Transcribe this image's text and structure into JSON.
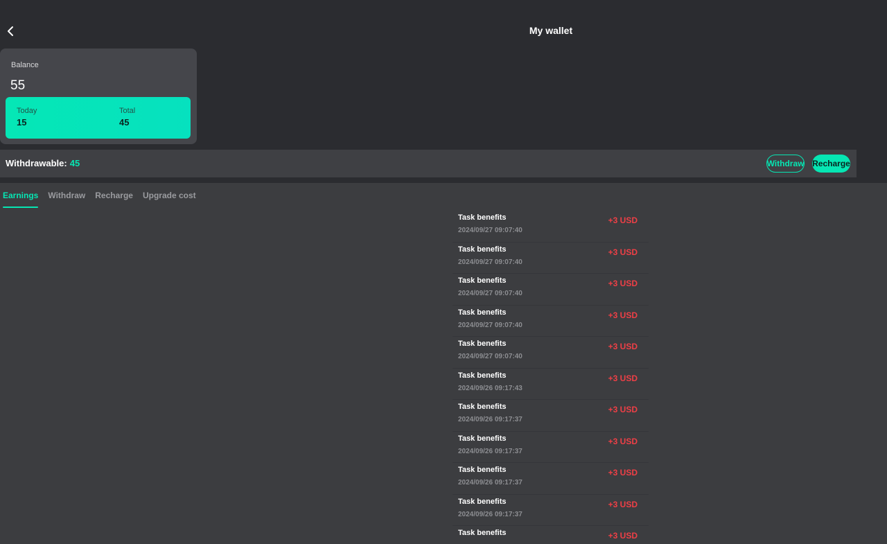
{
  "header": {
    "title": "My wallet",
    "back_icon": "chevron-left-icon"
  },
  "balance": {
    "label": "Balance",
    "value": "55",
    "today_label": "Today",
    "today_value": "15",
    "total_label": "Total",
    "total_value": "45"
  },
  "withdrawable": {
    "label": "Withdrawable:",
    "value": "45",
    "withdraw_button": "Withdraw",
    "recharge_button": "Recharge"
  },
  "tabs": [
    {
      "label": "Earnings",
      "active": true
    },
    {
      "label": "Withdraw",
      "active": false
    },
    {
      "label": "Recharge",
      "active": false
    },
    {
      "label": "Upgrade cost",
      "active": false
    }
  ],
  "records": [
    {
      "title": "Task benefits",
      "time": "2024/09/27 09:07:40",
      "amount": "+3 USD"
    },
    {
      "title": "Task benefits",
      "time": "2024/09/27 09:07:40",
      "amount": "+3 USD"
    },
    {
      "title": "Task benefits",
      "time": "2024/09/27 09:07:40",
      "amount": "+3 USD"
    },
    {
      "title": "Task benefits",
      "time": "2024/09/27 09:07:40",
      "amount": "+3 USD"
    },
    {
      "title": "Task benefits",
      "time": "2024/09/27 09:07:40",
      "amount": "+3 USD"
    },
    {
      "title": "Task benefits",
      "time": "2024/09/26 09:17:43",
      "amount": "+3 USD"
    },
    {
      "title": "Task benefits",
      "time": "2024/09/26 09:17:37",
      "amount": "+3 USD"
    },
    {
      "title": "Task benefits",
      "time": "2024/09/26 09:17:37",
      "amount": "+3 USD"
    },
    {
      "title": "Task benefits",
      "time": "2024/09/26 09:17:37",
      "amount": "+3 USD"
    },
    {
      "title": "Task benefits",
      "time": "2024/09/26 09:17:37",
      "amount": "+3 USD"
    },
    {
      "title": "Task benefits",
      "time": "",
      "amount": "+3 USD"
    }
  ],
  "colors": {
    "accent": "#06e6b3",
    "negative": "#ef3f46",
    "background": "#3c3d40",
    "header_bg": "#2b2c30"
  }
}
